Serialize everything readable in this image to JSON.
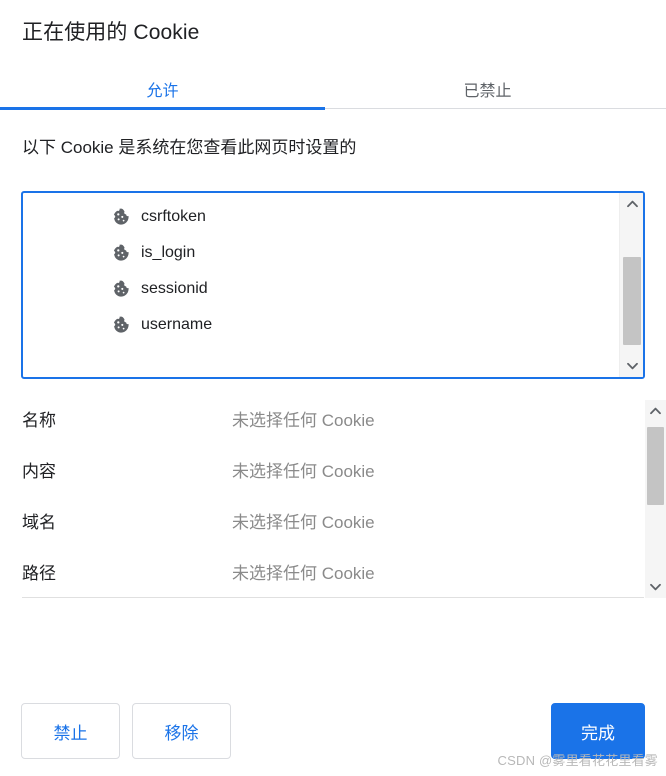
{
  "dialog": {
    "title": "正在使用的 Cookie",
    "description": "以下 Cookie 是系统在您查看此网页时设置的"
  },
  "tabs": [
    {
      "label": "允许",
      "active": true
    },
    {
      "label": "已禁止",
      "active": false
    }
  ],
  "cookie_list": {
    "icon": "cookie-icon",
    "items": [
      {
        "name": "csrftoken"
      },
      {
        "name": "is_login"
      },
      {
        "name": "sessionid"
      },
      {
        "name": "username"
      }
    ],
    "scrollbar": {
      "up_icon": "chevron-up-icon",
      "down_icon": "chevron-down-icon"
    }
  },
  "details": {
    "placeholder": "未选择任何 Cookie",
    "rows": [
      {
        "label": "名称",
        "value": "未选择任何 Cookie"
      },
      {
        "label": "内容",
        "value": "未选择任何 Cookie"
      },
      {
        "label": "域名",
        "value": "未选择任何 Cookie"
      },
      {
        "label": "路径",
        "value": "未选择任何 Cookie"
      }
    ],
    "scrollbar": {
      "up_icon": "chevron-up-icon",
      "down_icon": "chevron-down-icon"
    }
  },
  "footer": {
    "block_label": "禁止",
    "remove_label": "移除",
    "done_label": "完成"
  },
  "watermark": {
    "text": "CSDN @雾里看花花里看雾"
  },
  "colors": {
    "accent": "#1a73e8",
    "text_primary": "#202124",
    "text_secondary": "#5f6368",
    "text_muted": "#8a8a8a",
    "border": "#dadce0",
    "cookie_icon": "#5f6368",
    "scroll_thumb": "#c4c4c4",
    "scroll_track": "#f5f5f5"
  }
}
